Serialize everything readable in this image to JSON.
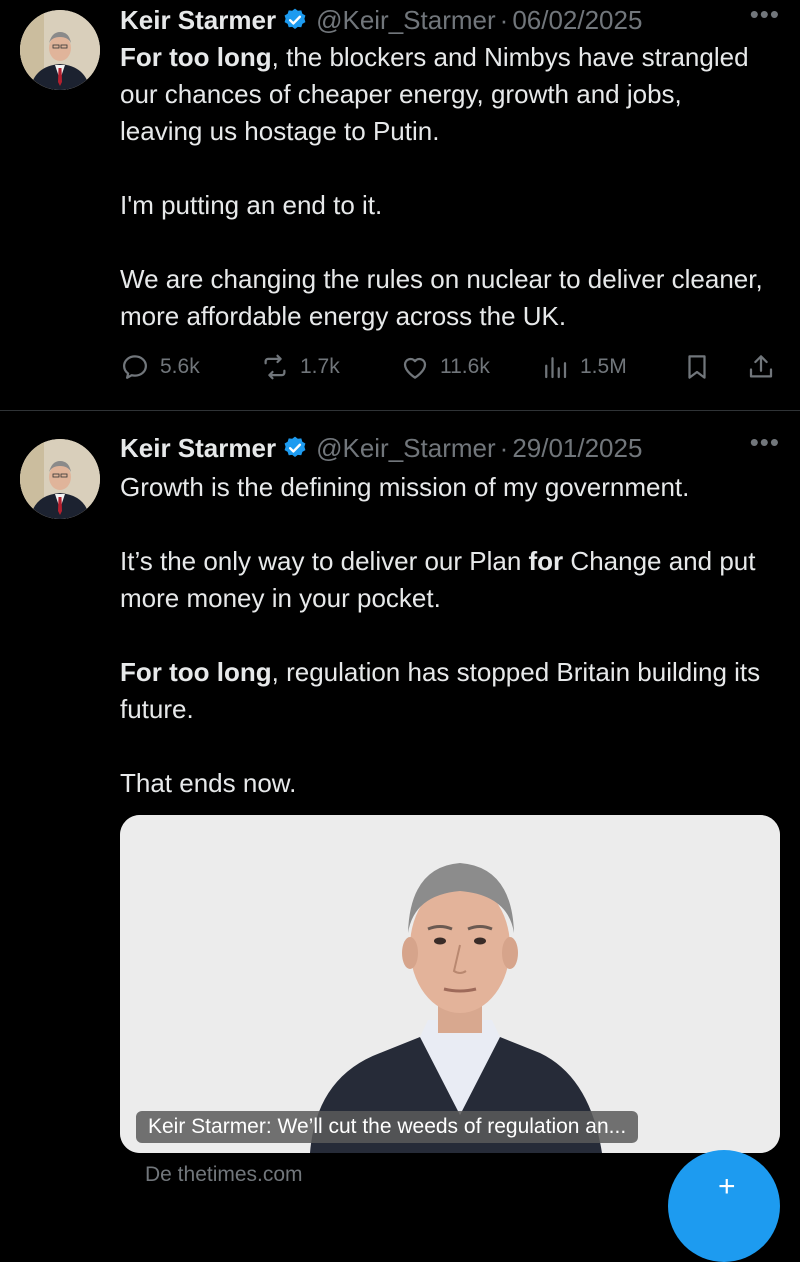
{
  "tweets": [
    {
      "author": "Keir Starmer",
      "handle": "@Keir_Starmer",
      "separator": "·",
      "date": "06/02/2025",
      "more": "•••",
      "body": {
        "p1_bold": "For too long",
        "p1_rest": ", the blockers and Nimbys have strangled our chances of cheaper energy, growth and jobs, leaving us hostage to Putin.",
        "p2": "I'm putting an end to it.",
        "p3": "We are changing the rules on nuclear to deliver cleaner, more affordable energy across the UK."
      },
      "stats": {
        "replies": "5.6k",
        "reposts": "1.7k",
        "likes": "11.6k",
        "views": "1.5M"
      }
    },
    {
      "author": "Keir Starmer",
      "handle": "@Keir_Starmer",
      "separator": "·",
      "date": "29/01/2025",
      "more": "•••",
      "body": {
        "p1": "Growth is the defining mission of my government.",
        "p2_a": "It’s the only way to deliver our Plan ",
        "p2_bold": "for",
        "p2_b": " Change and put more money in your pocket.",
        "p3_bold": "For too long",
        "p3_rest": ", regulation has stopped Britain building its future.",
        "p4": "That ends now."
      },
      "card": {
        "caption": "Keir Starmer: We’ll cut the weeds of regulation an...",
        "source": "De thetimes.com"
      }
    }
  ],
  "fab": {
    "icon": "plus-icon",
    "glyph": "+"
  },
  "colors": {
    "background": "#000000",
    "text": "#e7e9ea",
    "muted": "#71767b",
    "verified": "#1d9bf0",
    "accent": "#1d9bf0"
  }
}
